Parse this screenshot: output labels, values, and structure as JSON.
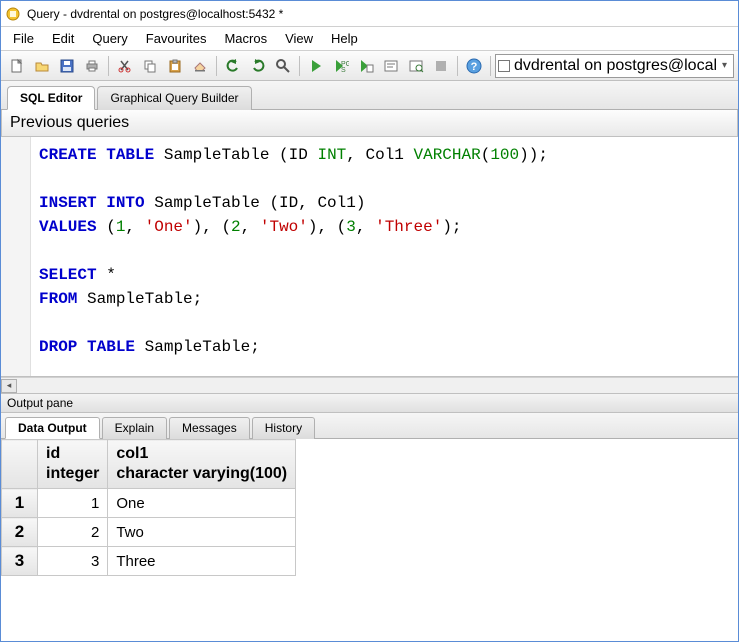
{
  "window": {
    "title": "Query - dvdrental on postgres@localhost:5432 *"
  },
  "menu": {
    "items": [
      "File",
      "Edit",
      "Query",
      "Favourites",
      "Macros",
      "View",
      "Help"
    ]
  },
  "db_selector": {
    "icon_label": "□",
    "value": "dvdrental on postgres@local"
  },
  "editor_tabs": {
    "active": "SQL Editor",
    "items": [
      "SQL Editor",
      "Graphical Query Builder"
    ]
  },
  "prev_queries_label": "Previous queries",
  "sql": {
    "tokens": [
      [
        {
          "t": "CREATE",
          "c": "kw"
        },
        {
          "t": " "
        },
        {
          "t": "TABLE",
          "c": "kw"
        },
        {
          "t": " SampleTable ("
        },
        {
          "t": "ID "
        },
        {
          "t": "INT",
          "c": "type"
        },
        {
          "t": ", Col1 "
        },
        {
          "t": "VARCHAR",
          "c": "type"
        },
        {
          "t": "("
        },
        {
          "t": "100",
          "c": "num"
        },
        {
          "t": "));"
        }
      ],
      [],
      [
        {
          "t": "INSERT",
          "c": "kw"
        },
        {
          "t": " "
        },
        {
          "t": "INTO",
          "c": "kw"
        },
        {
          "t": " SampleTable ("
        },
        {
          "t": "ID"
        },
        {
          "t": ", Col1)"
        }
      ],
      [
        {
          "t": "VALUES",
          "c": "kw"
        },
        {
          "t": " ("
        },
        {
          "t": "1",
          "c": "num"
        },
        {
          "t": ", "
        },
        {
          "t": "'One'",
          "c": "str"
        },
        {
          "t": "), ("
        },
        {
          "t": "2",
          "c": "num"
        },
        {
          "t": ", "
        },
        {
          "t": "'Two'",
          "c": "str"
        },
        {
          "t": "), ("
        },
        {
          "t": "3",
          "c": "num"
        },
        {
          "t": ", "
        },
        {
          "t": "'Three'",
          "c": "str"
        },
        {
          "t": ");"
        }
      ],
      [],
      [
        {
          "t": "SELECT",
          "c": "kw"
        },
        {
          "t": " *"
        }
      ],
      [
        {
          "t": "FROM",
          "c": "kw"
        },
        {
          "t": " SampleTable;"
        }
      ],
      [],
      [
        {
          "t": "DROP",
          "c": "kw"
        },
        {
          "t": " "
        },
        {
          "t": "TABLE",
          "c": "kw"
        },
        {
          "t": " SampleTable;"
        }
      ]
    ]
  },
  "output": {
    "pane_label": "Output pane",
    "tabs": [
      "Data Output",
      "Explain",
      "Messages",
      "History"
    ],
    "active_tab": "Data Output",
    "columns": [
      {
        "name": "id",
        "type": "integer"
      },
      {
        "name": "col1",
        "type": "character varying(100)"
      }
    ],
    "rows": [
      {
        "n": 1,
        "id": 1,
        "col1": "One"
      },
      {
        "n": 2,
        "id": 2,
        "col1": "Two"
      },
      {
        "n": 3,
        "id": 3,
        "col1": "Three"
      }
    ]
  },
  "toolbar_icons": [
    "new-file-icon",
    "open-icon",
    "save-icon",
    "print-icon",
    "cut-icon",
    "copy-icon",
    "paste-icon",
    "clear-icon",
    "undo-icon",
    "redo-icon",
    "find-icon",
    "execute-icon",
    "execute-pgscript-icon",
    "execute-file-icon",
    "explain-icon",
    "explain-analyze-icon",
    "stop-icon",
    "help-icon"
  ]
}
